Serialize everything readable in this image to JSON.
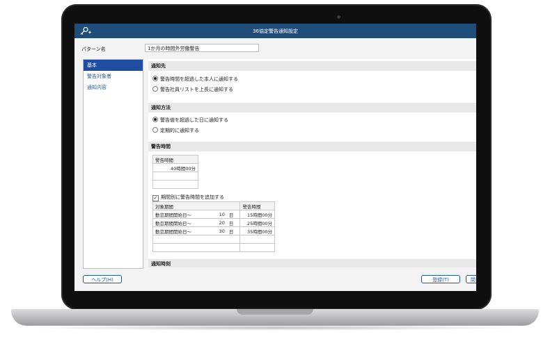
{
  "window": {
    "title": "36協定警告通知設定"
  },
  "form": {
    "name_label": "パターン名",
    "name_value": "1か月の時間外労働警告"
  },
  "sidebar": {
    "items": [
      {
        "label": "基本",
        "active": true
      },
      {
        "label": "警告対象者",
        "active": false
      },
      {
        "label": "通知内容",
        "active": false
      }
    ]
  },
  "sections": {
    "notify_to": {
      "title": "通知先",
      "options": [
        "警告時間を超過した本人に通知する",
        "警告社員リストを上長に通知する"
      ],
      "selected": 0
    },
    "notify_method": {
      "title": "通知方法",
      "options": [
        "警告値を超過した日に通知する",
        "定期的に通知する"
      ],
      "selected": 0
    },
    "warning_time": {
      "title": "警告時間",
      "table_header": "警告時間",
      "rows": [
        "40時間00分",
        "",
        ""
      ],
      "period_checkbox_label": "期間別に警告時間を追加する",
      "period_checked": true,
      "period_table": {
        "headers": [
          "対象期間",
          "警告時間"
        ],
        "rows": [
          {
            "period": "勤怠期間開始日～",
            "day": "10",
            "unit": "日",
            "time": "15時間00分"
          },
          {
            "period": "勤怠期間開始日～",
            "day": "20",
            "unit": "日",
            "time": "25時間00分"
          },
          {
            "period": "勤怠期間開始日～",
            "day": "30",
            "unit": "日",
            "time": "35時間00分"
          },
          {
            "period": "",
            "day": "",
            "unit": "",
            "time": ""
          },
          {
            "period": "",
            "day": "",
            "unit": "",
            "time": ""
          }
        ]
      }
    },
    "notify_time": {
      "title": "通知時刻"
    }
  },
  "footer": {
    "help_label": "ヘルプ(H)",
    "register_label": "登録(T)",
    "close_label_partial": "閉"
  },
  "colors": {
    "titlebar": "#1f4d79",
    "accent": "#1f5a95",
    "active_tab": "#1f4d9f"
  }
}
